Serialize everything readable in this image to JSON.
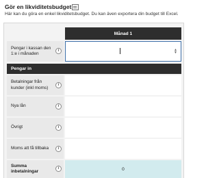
{
  "page": {
    "title": "Gör en likviditetsbudget",
    "intro": "Här kan du göra en enkel likviditetsbudget. Du kan även exportera din budget till Excel."
  },
  "table": {
    "column_header": "Månad 1",
    "opening_balance": {
      "label": "Pengar i kassan den 1:e i månaden",
      "value": ""
    },
    "section_income": "Pengar in",
    "income_rows": [
      {
        "label": "Betalningar från kunder (inkl moms)",
        "value": ""
      },
      {
        "label": "Nya lån",
        "value": ""
      },
      {
        "label": "Övrigt",
        "value": ""
      },
      {
        "label": "Moms att få tillbaka",
        "value": ""
      }
    ],
    "total_income": {
      "label": "Summa inbetalningar",
      "value": "0"
    }
  },
  "icons": {
    "info": "info-icon",
    "document": "document-icon"
  },
  "colors": {
    "header_bg": "#2e2e2e",
    "label_bg": "#e9e9e9",
    "sum_bg": "#d2ebee",
    "focus_border": "#3c6fa8"
  },
  "info_glyph": "i"
}
